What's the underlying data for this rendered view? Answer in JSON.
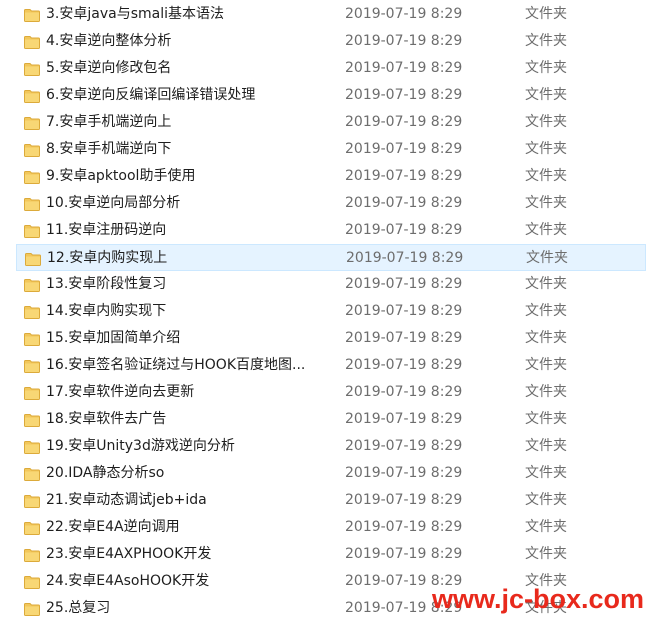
{
  "colors": {
    "folder": "#f2c75b",
    "folder_dark": "#dcaa3a",
    "selected_bg": "#e5f3ff",
    "watermark": "#e8291c"
  },
  "icons": {
    "folder": "folder-icon"
  },
  "files": [
    {
      "name": "3.安卓java与smali基本语法",
      "date": "2019-07-19 8:29",
      "type": "文件夹"
    },
    {
      "name": "4.安卓逆向整体分析",
      "date": "2019-07-19 8:29",
      "type": "文件夹"
    },
    {
      "name": "5.安卓逆向修改包名",
      "date": "2019-07-19 8:29",
      "type": "文件夹"
    },
    {
      "name": "6.安卓逆向反编译回编译错误处理",
      "date": "2019-07-19 8:29",
      "type": "文件夹"
    },
    {
      "name": "7.安卓手机端逆向上",
      "date": "2019-07-19 8:29",
      "type": "文件夹"
    },
    {
      "name": "8.安卓手机端逆向下",
      "date": "2019-07-19 8:29",
      "type": "文件夹"
    },
    {
      "name": "9.安卓apktool助手使用",
      "date": "2019-07-19 8:29",
      "type": "文件夹"
    },
    {
      "name": "10.安卓逆向局部分析",
      "date": "2019-07-19 8:29",
      "type": "文件夹"
    },
    {
      "name": "11.安卓注册码逆向",
      "date": "2019-07-19 8:29",
      "type": "文件夹"
    },
    {
      "name": "12.安卓内购实现上",
      "date": "2019-07-19 8:29",
      "type": "文件夹",
      "selected": true
    },
    {
      "name": "13.安卓阶段性复习",
      "date": "2019-07-19 8:29",
      "type": "文件夹"
    },
    {
      "name": "14.安卓内购实现下",
      "date": "2019-07-19 8:29",
      "type": "文件夹"
    },
    {
      "name": "15.安卓加固简单介绍",
      "date": "2019-07-19 8:29",
      "type": "文件夹"
    },
    {
      "name": "16.安卓签名验证绕过与HOOK百度地图...",
      "date": "2019-07-19 8:29",
      "type": "文件夹"
    },
    {
      "name": "17.安卓软件逆向去更新",
      "date": "2019-07-19 8:29",
      "type": "文件夹"
    },
    {
      "name": "18.安卓软件去广告",
      "date": "2019-07-19 8:29",
      "type": "文件夹"
    },
    {
      "name": "19.安卓Unity3d游戏逆向分析",
      "date": "2019-07-19 8:29",
      "type": "文件夹"
    },
    {
      "name": "20.IDA静态分析so",
      "date": "2019-07-19 8:29",
      "type": "文件夹"
    },
    {
      "name": "21.安卓动态调试jeb+ida",
      "date": "2019-07-19 8:29",
      "type": "文件夹"
    },
    {
      "name": "22.安卓E4A逆向调用",
      "date": "2019-07-19 8:29",
      "type": "文件夹"
    },
    {
      "name": "23.安卓E4AXPHOOK开发",
      "date": "2019-07-19 8:29",
      "type": "文件夹"
    },
    {
      "name": "24.安卓E4AsoHOOK开发",
      "date": "2019-07-19 8:29",
      "type": "文件夹"
    },
    {
      "name": "25.总复习",
      "date": "2019-07-19 8:29",
      "type": "文件夹"
    }
  ],
  "watermark": {
    "text": "www.jc-box.com"
  }
}
